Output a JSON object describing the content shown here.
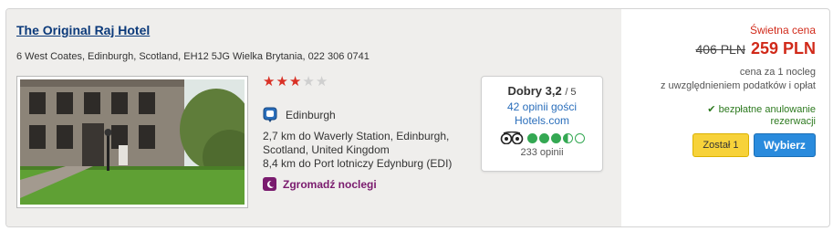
{
  "hotel": {
    "name": "The Original Raj Hotel",
    "address": "6 West Coates, Edinburgh, Scotland, EH12 5JG Wielka Brytania, 022 306 0741",
    "stars": 3,
    "max_stars": 5,
    "location": "Edinburgh",
    "distance_1": "2,7 km do Waverly Station, Edinburgh, Scotland, United Kingdom",
    "distance_2": "8,4 km do Port lotniczy Edynburg (EDI)",
    "collect_label": "Zgromadź noclegi"
  },
  "review": {
    "rating_label": "Dobry 3,2",
    "rating_max": "/ 5",
    "guest_reviews": "42 opinii gości",
    "source": "Hotels.com",
    "tripadvisor_bubbles": 3.5,
    "tripadvisor_count": "233 opinii",
    "tripadvisor_icon": "tripadvisor-owl-icon"
  },
  "pricing": {
    "deal_label": "Świetna cena",
    "old_price": "406 PLN",
    "new_price": "259 PLN",
    "price_note_1": "cena za 1 nocleg",
    "price_note_2": "z uwzględnieniem podatków i opłat",
    "cancel_line_1": "bezpłatne anulowanie",
    "cancel_line_2": "rezerwacji"
  },
  "actions": {
    "stay_label": "Został 1",
    "select_label": "Wybierz"
  },
  "colors": {
    "panel_bg": "#efeeec",
    "link_blue": "#0c3a7a",
    "price_red": "#d12a1a",
    "select_blue": "#2a8bdd",
    "stay_yellow": "#f7d23a",
    "collect_purple": "#7a1b6e",
    "ta_green": "#34a853"
  }
}
